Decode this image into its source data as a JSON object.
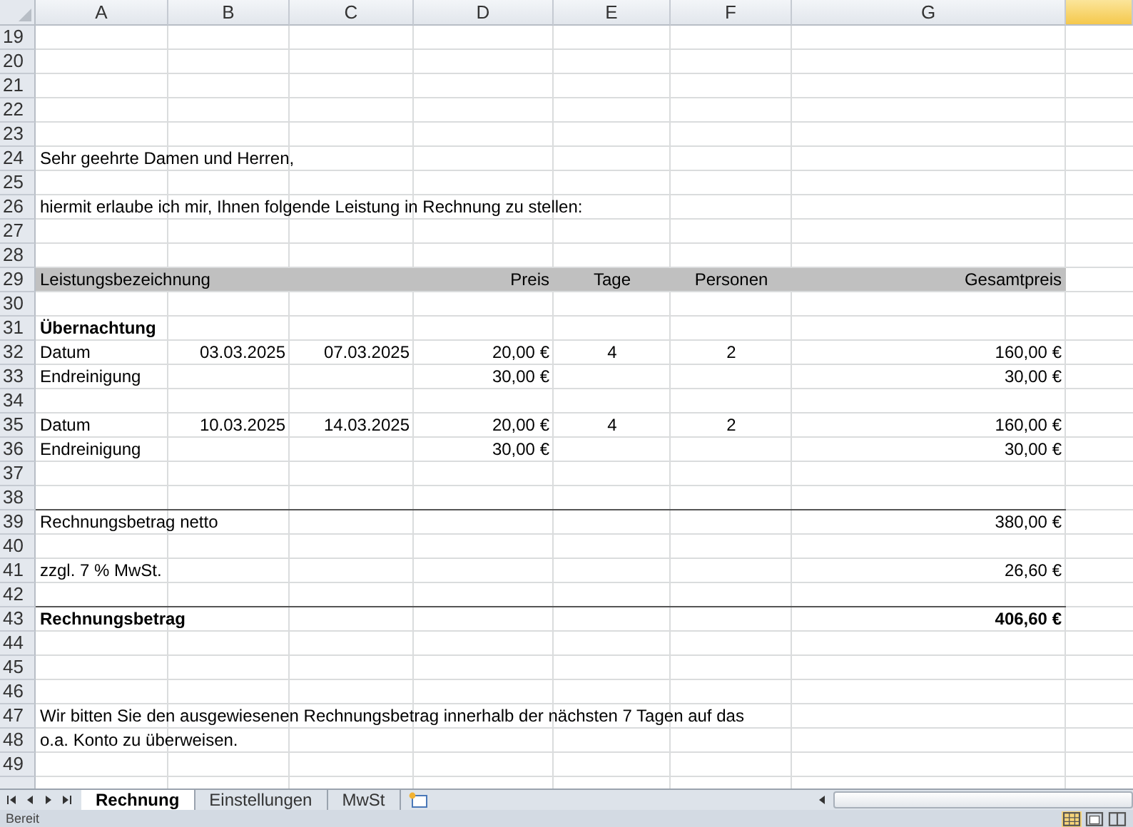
{
  "columns": [
    {
      "label": "A",
      "selected": false
    },
    {
      "label": "B",
      "selected": false
    },
    {
      "label": "C",
      "selected": false
    },
    {
      "label": "D",
      "selected": false
    },
    {
      "label": "E",
      "selected": false
    },
    {
      "label": "F",
      "selected": false
    },
    {
      "label": "G",
      "selected": false
    },
    {
      "selected": true
    }
  ],
  "rows": [
    {
      "number": "19"
    },
    {
      "number": "20"
    },
    {
      "number": "21"
    },
    {
      "number": "22"
    },
    {
      "number": "23"
    },
    {
      "number": "24",
      "kind": "text",
      "cells": [
        "Sehr geehrte Damen und Herren,"
      ]
    },
    {
      "number": "25"
    },
    {
      "number": "26",
      "kind": "text",
      "cells": [
        "hiermit erlaube ich mir, Ihnen folgende Leistung in Rechnung zu stellen:"
      ]
    },
    {
      "number": "27"
    },
    {
      "number": "28"
    },
    {
      "number": "29",
      "kind": "header",
      "cells": [
        "Leistungsbezeichnung",
        "Preis",
        "Tage",
        "Personen",
        "Gesamtpreis"
      ]
    },
    {
      "number": "30"
    },
    {
      "number": "31",
      "kind": "section",
      "cells": [
        "Übernachtung"
      ]
    },
    {
      "number": "32",
      "kind": "item",
      "cells": [
        "Datum",
        "03.03.2025",
        "07.03.2025",
        "20,00 €",
        "4",
        "2",
        "160,00 €"
      ]
    },
    {
      "number": "33",
      "kind": "charge",
      "cells": [
        "Endreinigung",
        "30,00 €",
        "30,00 €"
      ]
    },
    {
      "number": "34"
    },
    {
      "number": "35",
      "kind": "item",
      "cells": [
        "Datum",
        "10.03.2025",
        "14.03.2025",
        "20,00 €",
        "4",
        "2",
        "160,00 €"
      ]
    },
    {
      "number": "36",
      "kind": "charge",
      "cells": [
        "Endreinigung",
        "30,00 €",
        "30,00 €"
      ]
    },
    {
      "number": "37"
    },
    {
      "number": "38"
    },
    {
      "number": "39",
      "kind": "subtotal",
      "cells": [
        "Rechnungsbetrag netto",
        "380,00 €"
      ]
    },
    {
      "number": "40"
    },
    {
      "number": "41",
      "kind": "sum",
      "cells": [
        "zzgl. 7 % MwSt.",
        "26,60 €"
      ]
    },
    {
      "number": "42"
    },
    {
      "number": "43",
      "kind": "total",
      "cells": [
        "Rechnungsbetrag",
        "406,60 €"
      ]
    },
    {
      "number": "44"
    },
    {
      "number": "45"
    },
    {
      "number": "46"
    },
    {
      "number": "47",
      "kind": "text",
      "cells": [
        "Wir bitten Sie den ausgewiesenen Rechnungsbetrag innerhalb der nächsten 7 Tagen auf das"
      ]
    },
    {
      "number": "48",
      "kind": "text",
      "cells": [
        "o.a. Konto zu überweisen."
      ]
    },
    {
      "number": "49"
    }
  ],
  "sheet_tabs": [
    {
      "label": "Rechnung",
      "selected": true
    },
    {
      "label": "Einstellungen",
      "selected": false
    },
    {
      "label": "MwSt",
      "selected": false
    }
  ],
  "status_bar": {
    "text": "Bereit"
  }
}
